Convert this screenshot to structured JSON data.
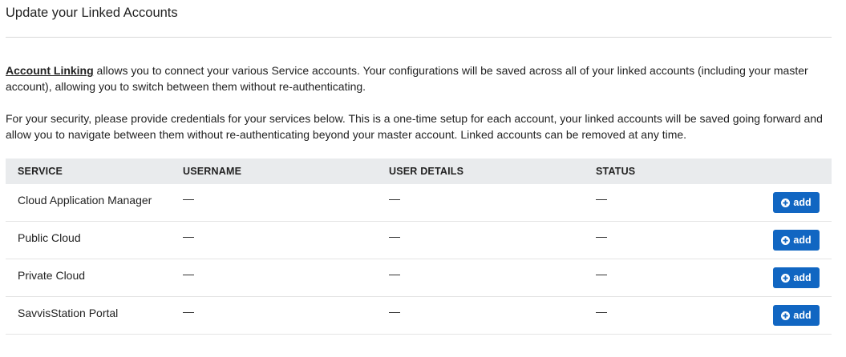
{
  "page": {
    "title": "Update your Linked Accounts"
  },
  "intro": {
    "link_text": "Account Linking",
    "para1_rest": " allows you to connect your various Service accounts. Your configurations will be saved across all of your linked accounts (including your master account), allowing you to switch between them without re-authenticating.",
    "para2": "For your security, please provide credentials for your services below. This is a one-time setup for each account, your linked accounts will be saved going forward and allow you to navigate between them without re-authenticating beyond your master account. Linked accounts can be removed at any time."
  },
  "table": {
    "headers": {
      "service": "SERVICE",
      "username": "USERNAME",
      "user_details": "USER DETAILS",
      "status": "STATUS"
    },
    "rows": [
      {
        "service": "Cloud Application Manager",
        "username": "—",
        "user_details": "—",
        "status": "—",
        "action": "add"
      },
      {
        "service": "Public Cloud",
        "username": "—",
        "user_details": "—",
        "status": "—",
        "action": "add"
      },
      {
        "service": "Private Cloud",
        "username": "—",
        "user_details": "—",
        "status": "—",
        "action": "add"
      },
      {
        "service": "SavvisStation Portal",
        "username": "—",
        "user_details": "—",
        "status": "—",
        "action": "add"
      }
    ]
  },
  "icons": {
    "add_button_icon": "plus-circle-icon"
  },
  "colors": {
    "accent": "#1166c2",
    "header_bg": "#e9ebed"
  }
}
